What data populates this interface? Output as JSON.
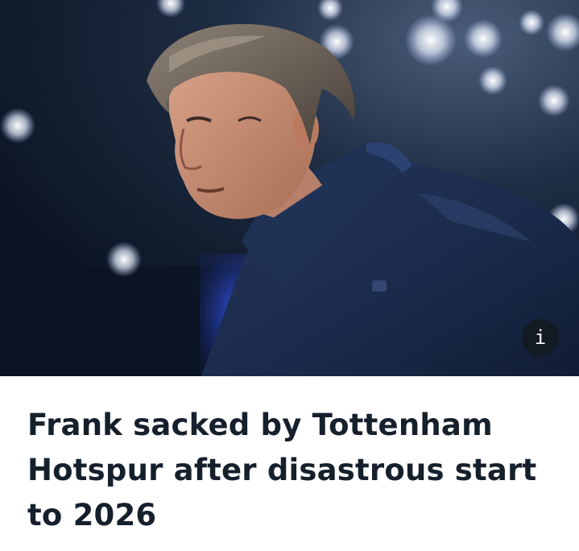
{
  "article": {
    "headline": "Frank sacked by Tottenham Hotspur after disastrous start to 2026",
    "info_label": "i",
    "image_icon": "photo-of-man-in-navy-coat"
  },
  "colors": {
    "headline_text": "#16202c",
    "coat_navy": "#1b2a4a",
    "background_dark": "#0f1b2c",
    "info_button_bg": "#121a24"
  }
}
